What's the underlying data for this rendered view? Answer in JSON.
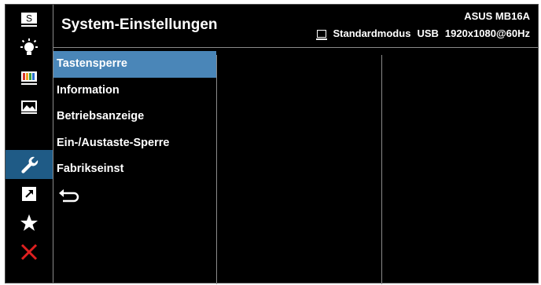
{
  "colors": {
    "background": "#000000",
    "active_sidebar": "#1f5b86",
    "selected_item": "#4a86b8",
    "divider": "#8a8a8a",
    "close_icon": "#e02020",
    "color_bars": [
      "#d4342c",
      "#f0a020",
      "#3aa040",
      "#2a6fd0",
      "#9b3fb8"
    ]
  },
  "header": {
    "title": "System-Einstellungen",
    "model": "ASUS MB16A",
    "mode": "Standardmodus",
    "input": "USB",
    "resolution": "1920x1080@60Hz",
    "mode_icon": "monitor-icon"
  },
  "sidebar": {
    "items": [
      {
        "icon": "splendid-s-icon",
        "label": "S"
      },
      {
        "icon": "brightness-icon"
      },
      {
        "icon": "color-icon"
      },
      {
        "icon": "image-icon"
      },
      {
        "icon": "wrench-icon",
        "active": true
      },
      {
        "icon": "shortcut-icon"
      },
      {
        "icon": "star-icon"
      },
      {
        "icon": "close-icon"
      }
    ]
  },
  "menu": {
    "items": [
      {
        "label": "Tastensperre",
        "selected": true
      },
      {
        "label": "Information"
      },
      {
        "label": "Betriebsanzeige"
      },
      {
        "label": "Ein-/Austaste-Sperre"
      },
      {
        "label": "Fabrikseinst"
      }
    ],
    "back_icon": "back-arrow-icon"
  }
}
